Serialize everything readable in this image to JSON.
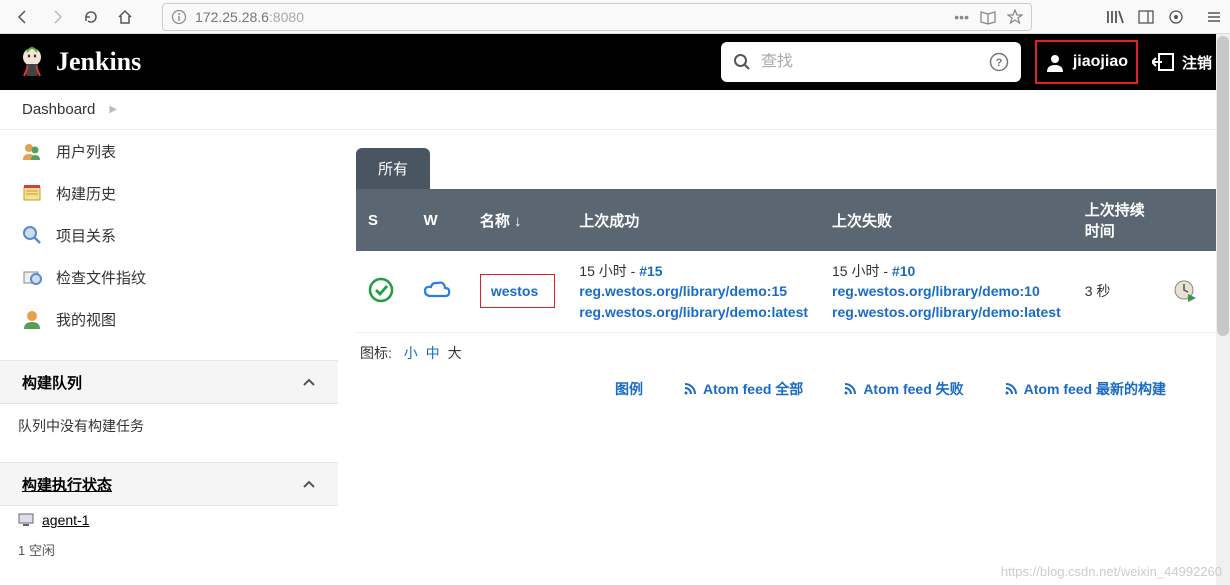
{
  "browser": {
    "address_host": "172.25.28.6",
    "address_port": ":8080"
  },
  "header": {
    "brand": "Jenkins",
    "search_placeholder": "查找",
    "username": "jiaojiao",
    "logout": "注销"
  },
  "breadcrumb": {
    "root": "Dashboard"
  },
  "sidebar": {
    "items": [
      {
        "label": "用户列表"
      },
      {
        "label": "构建历史"
      },
      {
        "label": "项目关系"
      },
      {
        "label": "检查文件指纹"
      },
      {
        "label": "我的视图"
      }
    ],
    "queue_header": "构建队列",
    "queue_empty": "队列中没有构建任务",
    "executor_header": "构建执行状态",
    "agent_label": "agent-1",
    "idle_row": "1  空闲"
  },
  "tabs": {
    "all": "所有"
  },
  "table": {
    "headers": {
      "s": "S",
      "w": "W",
      "name": "名称 ↓",
      "last_success": "上次成功",
      "last_fail": "上次失败",
      "last_duration": "上次持续时间"
    },
    "rows": [
      {
        "name": "westos",
        "success_time": "15 小时 - ",
        "success_build": "#15",
        "success_repo1": "reg.westos.org/library/demo:15",
        "success_repo2": "reg.westos.org/library/demo:latest",
        "fail_time": "15 小时 - ",
        "fail_build": "#10",
        "fail_repo1": "reg.westos.org/library/demo:10",
        "fail_repo2": "reg.westos.org/library/demo:latest",
        "duration": "3 秒"
      }
    ]
  },
  "icon_size": {
    "label": "图标:",
    "small": "小",
    "medium": "中",
    "large": "大"
  },
  "feeds": {
    "legend": "图例",
    "all": "Atom feed 全部",
    "fail": "Atom feed 失败",
    "latest": "Atom feed 最新的构建"
  },
  "watermark": "https://blog.csdn.net/weixin_44992260"
}
